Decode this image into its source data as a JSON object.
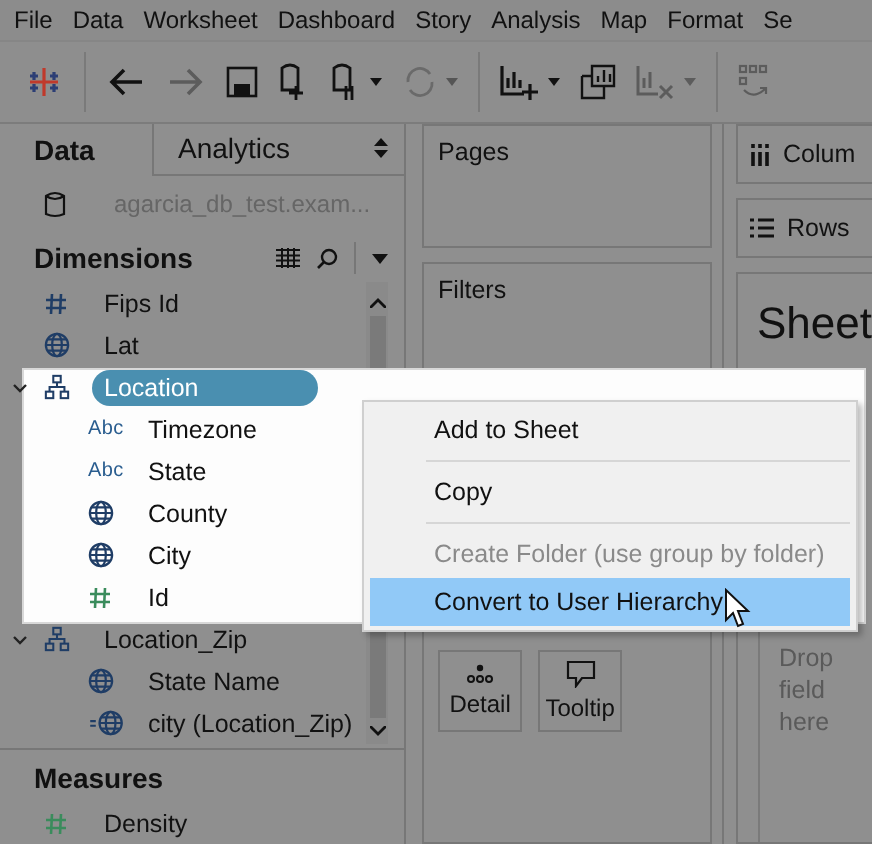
{
  "menu_bar": [
    "File",
    "Data",
    "Worksheet",
    "Dashboard",
    "Story",
    "Analysis",
    "Map",
    "Format",
    "Se"
  ],
  "data_pane": {
    "tabs": [
      {
        "label": "Data",
        "selected": true
      },
      {
        "label": "Analytics",
        "selected": false
      }
    ],
    "datasource": "agarcia_db_test.exam...",
    "dimensions": {
      "title": "Dimensions",
      "fields": [
        {
          "label": "Fips Id",
          "kind": "number",
          "continuous": false,
          "selected": false
        },
        {
          "label": "Lat",
          "kind": "geo",
          "continuous": false,
          "selected": false
        },
        {
          "label": "Location",
          "kind": "hierarchy",
          "selected": true,
          "expanded": true,
          "children": [
            {
              "label": "Timezone",
              "kind": "string",
              "type_label": "Abc",
              "continuous": false,
              "selected": false
            },
            {
              "label": "State",
              "kind": "string",
              "type_label": "Abc",
              "continuous": false,
              "selected": false
            },
            {
              "label": "County",
              "kind": "geo",
              "continuous": false,
              "selected": false
            },
            {
              "label": "City",
              "kind": "geo",
              "continuous": false,
              "selected": false
            },
            {
              "label": "Id",
              "kind": "number",
              "continuous": true,
              "selected": false
            }
          ]
        },
        {
          "label": "Location_Zip",
          "kind": "hierarchy",
          "selected": false,
          "expanded": true,
          "children": [
            {
              "label": "State Name",
              "kind": "geo",
              "continuous": false,
              "selected": false
            },
            {
              "label": "city (Location_Zip)",
              "kind": "geo-calc",
              "continuous": false,
              "selected": false
            }
          ]
        }
      ]
    },
    "measures": {
      "title": "Measures",
      "fields": [
        {
          "label": "Density",
          "kind": "number",
          "continuous": true,
          "selected": false
        }
      ]
    }
  },
  "pages": {
    "title": "Pages"
  },
  "filters": {
    "title": "Filters"
  },
  "marks": {
    "buttons": [
      {
        "label": "Detail",
        "kind": "detail"
      },
      {
        "label": "Tooltip",
        "kind": "tooltip"
      }
    ]
  },
  "columns_shelf": {
    "label": "Colum"
  },
  "rows_shelf": {
    "label": "Rows"
  },
  "sheet": {
    "title": "Sheet",
    "drop_hint": "Drop field here"
  },
  "context_menu": {
    "items": [
      {
        "kind": "item",
        "label": "Add to Sheet",
        "disabled": false,
        "selected": false
      },
      {
        "kind": "separator"
      },
      {
        "kind": "item",
        "label": "Copy",
        "disabled": false,
        "selected": false
      },
      {
        "kind": "separator"
      },
      {
        "kind": "item",
        "label": "Create Folder (use group by folder)",
        "disabled": true,
        "selected": false
      },
      {
        "kind": "item",
        "label": "Convert to User Hierarchy",
        "disabled": false,
        "selected": true
      }
    ]
  }
}
